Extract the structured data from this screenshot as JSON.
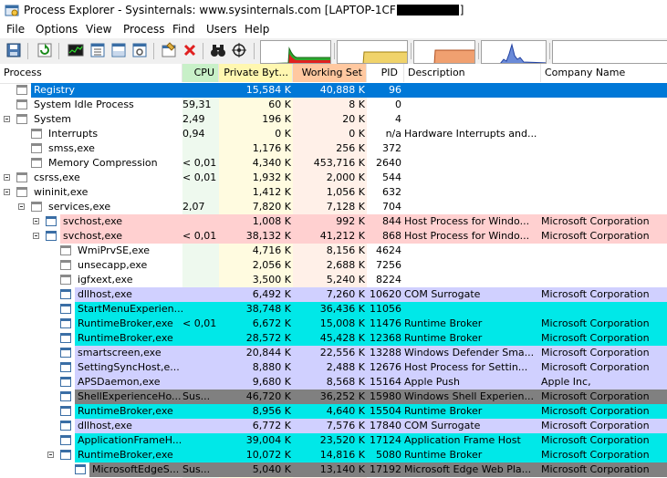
{
  "window": {
    "title": "Process Explorer - Sysinternals: www.sysinternals.com [LAPTOP-1CF",
    "title_end": "]"
  },
  "menu": [
    "File",
    "Options",
    "View",
    "Process",
    "Find",
    "Users",
    "Help"
  ],
  "columns": {
    "process": "Process",
    "cpu": "CPU",
    "private_bytes": "Private Byt...",
    "working_set": "Working Set",
    "pid": "PID",
    "description": "Description",
    "company": "Company Name"
  },
  "colors": {
    "selected": "#0078d7",
    "service": "#ffd0d0",
    "immersive": "#00e8e8",
    "own": "#d0d0ff",
    "suspended": "#808080"
  },
  "rows": [
    {
      "name": "Registry",
      "cpu": "",
      "priv": "15,584 K",
      "ws": "40,888 K",
      "pid": "96",
      "desc": "",
      "comp": "",
      "style": "selected"
    },
    {
      "name": "System Idle Process",
      "cpu": "59,31",
      "priv": "60 K",
      "ws": "8 K",
      "pid": "0",
      "desc": "",
      "comp": "",
      "style": ""
    },
    {
      "name": "System",
      "cpu": "2,49",
      "priv": "196 K",
      "ws": "20 K",
      "pid": "4",
      "desc": "",
      "comp": "",
      "style": ""
    },
    {
      "name": "Interrupts",
      "cpu": "0,94",
      "priv": "0 K",
      "ws": "0 K",
      "pid": "n/a",
      "desc": "Hardware Interrupts and...",
      "comp": "",
      "style": ""
    },
    {
      "name": "smss,exe",
      "cpu": "",
      "priv": "1,176 K",
      "ws": "256 K",
      "pid": "372",
      "desc": "",
      "comp": "",
      "style": ""
    },
    {
      "name": "Memory Compression",
      "cpu": "< 0,01",
      "priv": "4,340 K",
      "ws": "453,716 K",
      "pid": "2640",
      "desc": "",
      "comp": "",
      "style": ""
    },
    {
      "name": "csrss,exe",
      "cpu": "< 0,01",
      "priv": "1,932 K",
      "ws": "2,000 K",
      "pid": "544",
      "desc": "",
      "comp": "",
      "style": ""
    },
    {
      "name": "wininit,exe",
      "cpu": "",
      "priv": "1,412 K",
      "ws": "1,056 K",
      "pid": "632",
      "desc": "",
      "comp": "",
      "style": ""
    },
    {
      "name": "services,exe",
      "cpu": "2,07",
      "priv": "7,820 K",
      "ws": "7,128 K",
      "pid": "704",
      "desc": "",
      "comp": "",
      "style": ""
    },
    {
      "name": "svchost,exe",
      "cpu": "",
      "priv": "1,008 K",
      "ws": "992 K",
      "pid": "844",
      "desc": "Host Process for Windo...",
      "comp": "Microsoft Corporation",
      "style": "service"
    },
    {
      "name": "svchost,exe",
      "cpu": "< 0,01",
      "priv": "38,132 K",
      "ws": "41,212 K",
      "pid": "868",
      "desc": "Host Process for Windo...",
      "comp": "Microsoft Corporation",
      "style": "service"
    },
    {
      "name": "WmiPrvSE,exe",
      "cpu": "",
      "priv": "4,716 K",
      "ws": "8,156 K",
      "pid": "4624",
      "desc": "",
      "comp": "",
      "style": ""
    },
    {
      "name": "unsecapp,exe",
      "cpu": "",
      "priv": "2,056 K",
      "ws": "2,688 K",
      "pid": "7256",
      "desc": "",
      "comp": "",
      "style": ""
    },
    {
      "name": "igfxext,exe",
      "cpu": "",
      "priv": "3,500 K",
      "ws": "5,240 K",
      "pid": "8224",
      "desc": "",
      "comp": "",
      "style": ""
    },
    {
      "name": "dllhost,exe",
      "cpu": "",
      "priv": "6,492 K",
      "ws": "7,260 K",
      "pid": "10620",
      "desc": "COM Surrogate",
      "comp": "Microsoft Corporation",
      "style": "own"
    },
    {
      "name": "StartMenuExperien...",
      "cpu": "",
      "priv": "38,748 K",
      "ws": "36,436 K",
      "pid": "11056",
      "desc": "",
      "comp": "",
      "style": "immersive"
    },
    {
      "name": "RuntimeBroker,exe",
      "cpu": "< 0,01",
      "priv": "6,672 K",
      "ws": "15,008 K",
      "pid": "11476",
      "desc": "Runtime Broker",
      "comp": "Microsoft Corporation",
      "style": "immersive"
    },
    {
      "name": "RuntimeBroker,exe",
      "cpu": "",
      "priv": "28,572 K",
      "ws": "45,428 K",
      "pid": "12368",
      "desc": "Runtime Broker",
      "comp": "Microsoft Corporation",
      "style": "immersive"
    },
    {
      "name": "smartscreen,exe",
      "cpu": "",
      "priv": "20,844 K",
      "ws": "22,556 K",
      "pid": "13288",
      "desc": "Windows Defender Sma...",
      "comp": "Microsoft Corporation",
      "style": "own"
    },
    {
      "name": "SettingSyncHost,e...",
      "cpu": "",
      "priv": "8,880 K",
      "ws": "2,488 K",
      "pid": "12676",
      "desc": "Host Process for Settin...",
      "comp": "Microsoft Corporation",
      "style": "own"
    },
    {
      "name": "APSDaemon,exe",
      "cpu": "",
      "priv": "9,680 K",
      "ws": "8,568 K",
      "pid": "15164",
      "desc": "Apple Push",
      "comp": "Apple Inc,",
      "style": "own"
    },
    {
      "name": "ShellExperienceHo...",
      "cpu": "Sus...",
      "priv": "46,720 K",
      "ws": "36,252 K",
      "pid": "15980",
      "desc": "Windows Shell Experien...",
      "comp": "Microsoft Corporation",
      "style": "suspended"
    },
    {
      "name": "RuntimeBroker,exe",
      "cpu": "",
      "priv": "8,956 K",
      "ws": "4,640 K",
      "pid": "15504",
      "desc": "Runtime Broker",
      "comp": "Microsoft Corporation",
      "style": "immersive"
    },
    {
      "name": "dllhost,exe",
      "cpu": "",
      "priv": "6,772 K",
      "ws": "7,576 K",
      "pid": "17840",
      "desc": "COM Surrogate",
      "comp": "Microsoft Corporation",
      "style": "own"
    },
    {
      "name": "ApplicationFrameH...",
      "cpu": "",
      "priv": "39,004 K",
      "ws": "23,520 K",
      "pid": "17124",
      "desc": "Application Frame Host",
      "comp": "Microsoft Corporation",
      "style": "immersive"
    },
    {
      "name": "RuntimeBroker,exe",
      "cpu": "",
      "priv": "10,072 K",
      "ws": "14,816 K",
      "pid": "5080",
      "desc": "Runtime Broker",
      "comp": "Microsoft Corporation",
      "style": "immersive"
    },
    {
      "name": "MicrosoftEdgeS...",
      "cpu": "Sus...",
      "priv": "5,040 K",
      "ws": "13,140 K",
      "pid": "17192",
      "desc": "Microsoft Edge Web Pla...",
      "comp": "Microsoft Corporation",
      "style": "suspended"
    }
  ]
}
